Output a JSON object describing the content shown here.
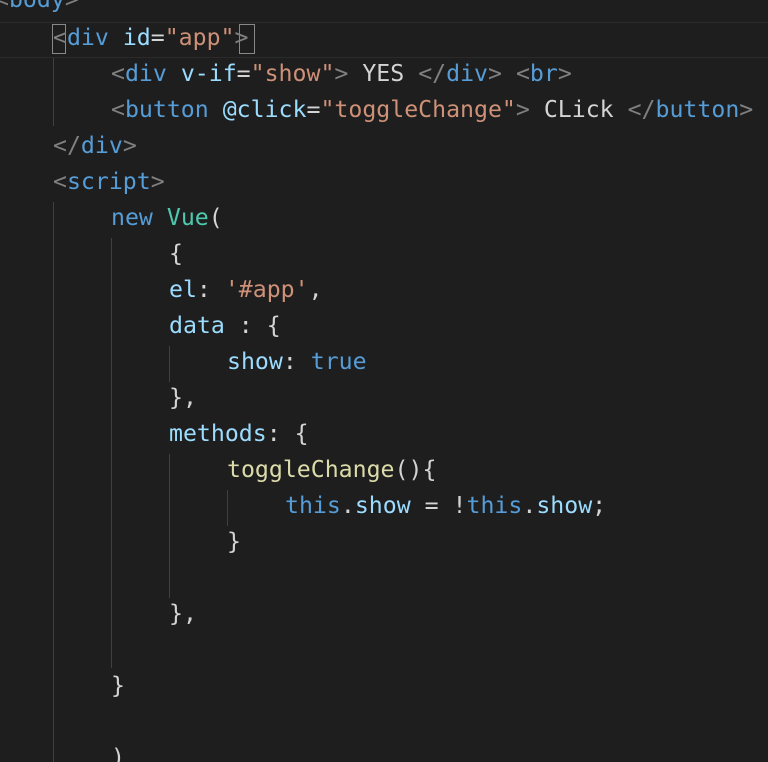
{
  "colors": {
    "background": "#1e1e1e",
    "tag": "#569cd6",
    "punctuation": "#808080",
    "attribute": "#9cdcfe",
    "string": "#ce9178",
    "text": "#d4d4d4",
    "class_name": "#4ec9b0",
    "function": "#dcdcaa",
    "indent_guide": "#404040"
  },
  "code": {
    "lines": [
      [
        {
          "t": "<",
          "c": "punctuation"
        },
        {
          "t": "body",
          "c": "tag"
        },
        {
          "t": ">",
          "c": "punctuation"
        }
      ],
      [
        {
          "t": "<",
          "c": "punctuation"
        },
        {
          "t": "div",
          "c": "tag"
        },
        {
          "t": " ",
          "c": "text"
        },
        {
          "t": "id",
          "c": "attribute"
        },
        {
          "t": "=",
          "c": "text"
        },
        {
          "t": "\"app\"",
          "c": "string"
        },
        {
          "t": ">",
          "c": "punctuation"
        }
      ],
      [
        {
          "t": "<",
          "c": "punctuation"
        },
        {
          "t": "div",
          "c": "tag"
        },
        {
          "t": " ",
          "c": "text"
        },
        {
          "t": "v-if",
          "c": "attribute"
        },
        {
          "t": "=",
          "c": "text"
        },
        {
          "t": "\"show\"",
          "c": "string"
        },
        {
          "t": ">",
          "c": "punctuation"
        },
        {
          "t": " YES ",
          "c": "text"
        },
        {
          "t": "</",
          "c": "punctuation"
        },
        {
          "t": "div",
          "c": "tag"
        },
        {
          "t": ">",
          "c": "punctuation"
        },
        {
          "t": " ",
          "c": "text"
        },
        {
          "t": "<",
          "c": "punctuation"
        },
        {
          "t": "br",
          "c": "tag"
        },
        {
          "t": ">",
          "c": "punctuation"
        }
      ],
      [
        {
          "t": "<",
          "c": "punctuation"
        },
        {
          "t": "button",
          "c": "tag"
        },
        {
          "t": " ",
          "c": "text"
        },
        {
          "t": "@click",
          "c": "attribute"
        },
        {
          "t": "=",
          "c": "text"
        },
        {
          "t": "\"toggleChange\"",
          "c": "string"
        },
        {
          "t": ">",
          "c": "punctuation"
        },
        {
          "t": " CLick ",
          "c": "text"
        },
        {
          "t": "</",
          "c": "punctuation"
        },
        {
          "t": "button",
          "c": "tag"
        },
        {
          "t": ">",
          "c": "punctuation"
        }
      ],
      [
        {
          "t": "</",
          "c": "punctuation"
        },
        {
          "t": "div",
          "c": "tag"
        },
        {
          "t": ">",
          "c": "punctuation"
        }
      ],
      [
        {
          "t": "<",
          "c": "punctuation"
        },
        {
          "t": "script",
          "c": "tag"
        },
        {
          "t": ">",
          "c": "punctuation"
        }
      ],
      [
        {
          "t": "new",
          "c": "tag"
        },
        {
          "t": " ",
          "c": "text"
        },
        {
          "t": "Vue",
          "c": "class_name"
        },
        {
          "t": "(",
          "c": "text"
        }
      ],
      [
        {
          "t": "{",
          "c": "text"
        }
      ],
      [
        {
          "t": "el",
          "c": "attribute"
        },
        {
          "t": ": ",
          "c": "text"
        },
        {
          "t": "'#app'",
          "c": "string"
        },
        {
          "t": ",",
          "c": "text"
        }
      ],
      [
        {
          "t": "data",
          "c": "attribute"
        },
        {
          "t": " : {",
          "c": "text"
        }
      ],
      [
        {
          "t": "show",
          "c": "attribute"
        },
        {
          "t": ": ",
          "c": "text"
        },
        {
          "t": "true",
          "c": "tag"
        }
      ],
      [
        {
          "t": "},",
          "c": "text"
        }
      ],
      [
        {
          "t": "methods",
          "c": "attribute"
        },
        {
          "t": ": {",
          "c": "text"
        }
      ],
      [
        {
          "t": "toggleChange",
          "c": "function"
        },
        {
          "t": "(){",
          "c": "text"
        }
      ],
      [
        {
          "t": "this",
          "c": "tag"
        },
        {
          "t": ".",
          "c": "text"
        },
        {
          "t": "show",
          "c": "attribute"
        },
        {
          "t": " = !",
          "c": "text"
        },
        {
          "t": "this",
          "c": "tag"
        },
        {
          "t": ".",
          "c": "text"
        },
        {
          "t": "show",
          "c": "attribute"
        },
        {
          "t": ";",
          "c": "text"
        }
      ],
      [
        {
          "t": "}",
          "c": "text"
        }
      ],
      [],
      [
        {
          "t": "},",
          "c": "text"
        }
      ],
      [],
      [
        {
          "t": "}",
          "c": "text"
        }
      ],
      [],
      [
        {
          "t": ")",
          "c": "text"
        }
      ]
    ]
  }
}
